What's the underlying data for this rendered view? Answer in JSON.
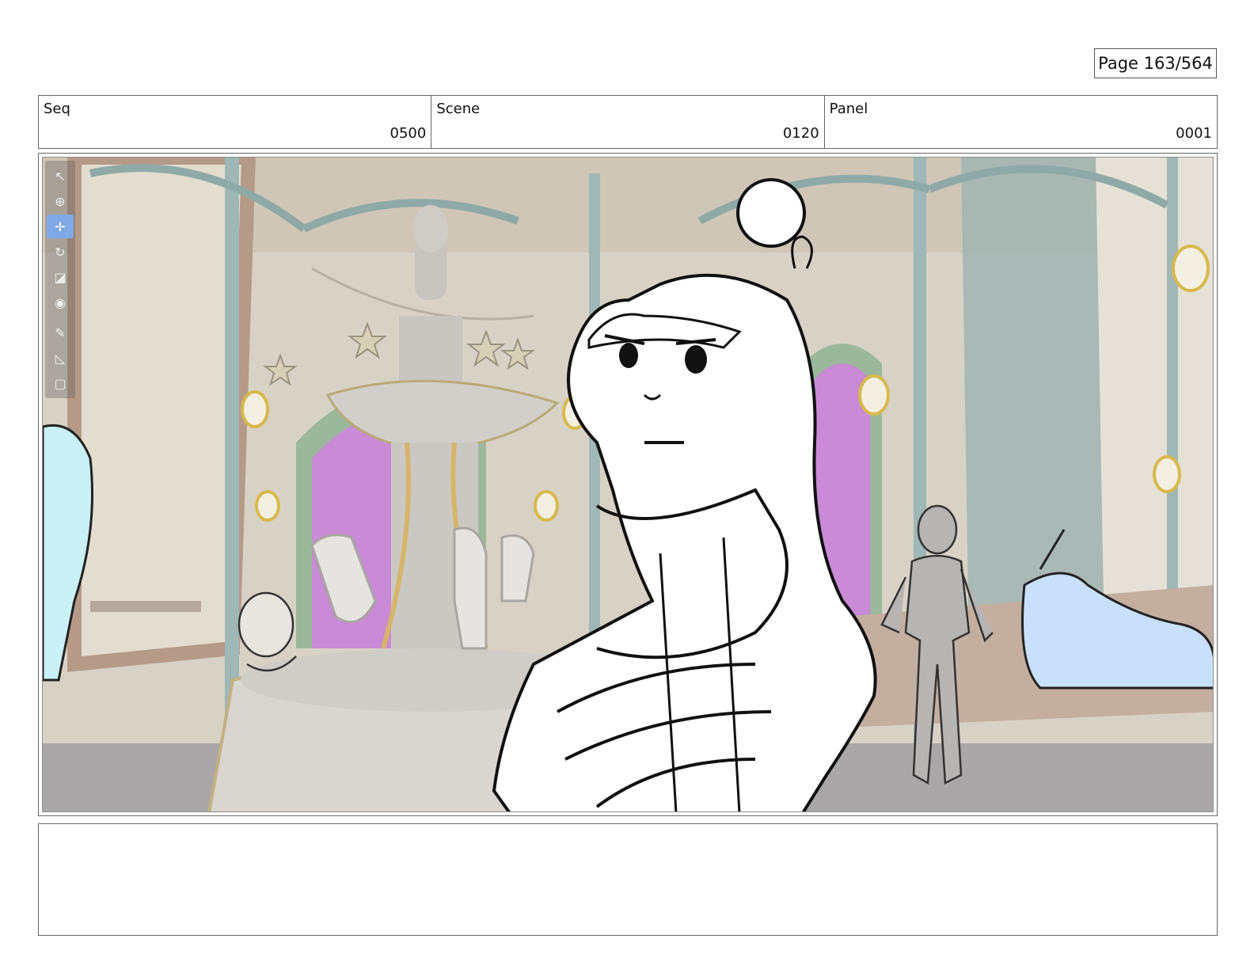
{
  "page": {
    "label": "Page 163/564"
  },
  "header": {
    "seq": {
      "label": "Seq",
      "value": "0500"
    },
    "scene": {
      "label": "Scene",
      "value": "0120"
    },
    "panel": {
      "label": "Panel",
      "value": "0001"
    }
  },
  "toolbar": {
    "tools": [
      "select-icon",
      "camera-icon",
      "transform-icon",
      "rotate-icon",
      "scale-icon",
      "pivot-icon",
      "brush-icon",
      "ruler-icon",
      "new-layer-icon"
    ],
    "active_tool": "transform-icon"
  },
  "notes": {
    "text": ""
  },
  "colors": {
    "accent": "#7fa8e6",
    "portal_magenta": "#c98ad6",
    "ironwork": "#9fb7b5"
  }
}
